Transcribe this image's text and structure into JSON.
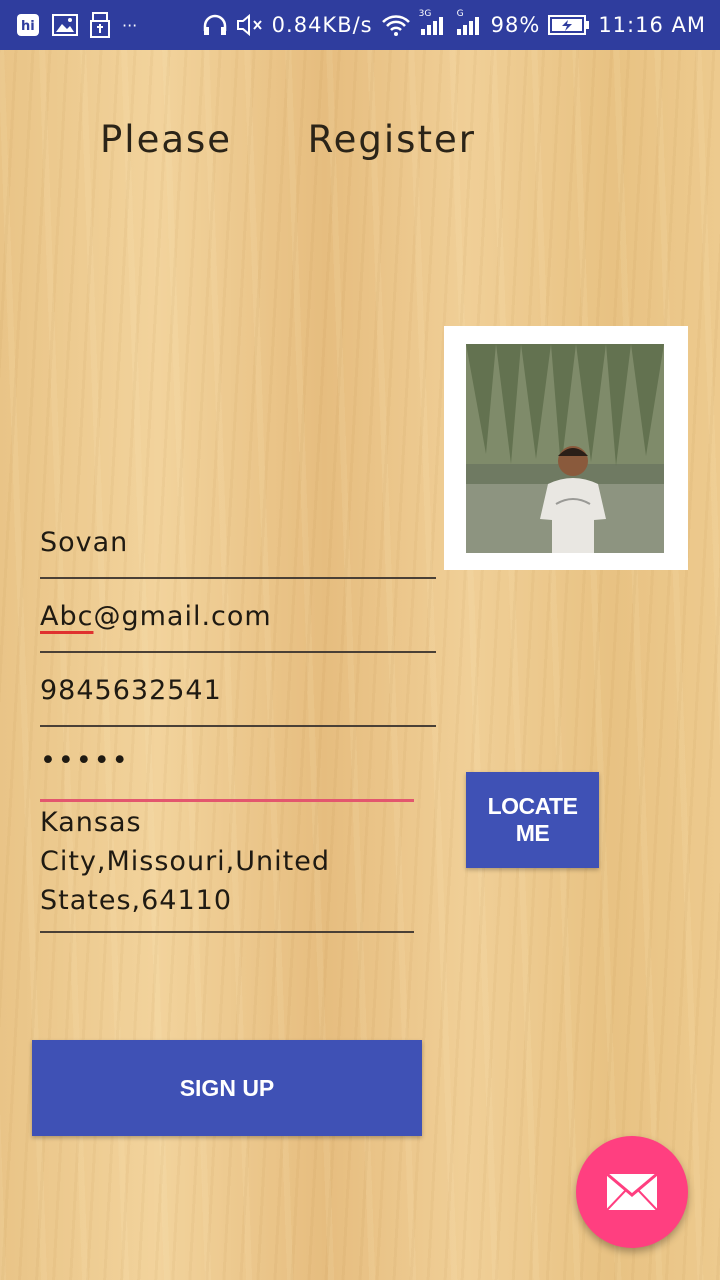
{
  "status_bar": {
    "network_speed": "0.84KB/s",
    "network_type_1": "3G",
    "network_type_2": "G",
    "battery": "98%",
    "time": "11:16 AM",
    "overflow": "···"
  },
  "page": {
    "title": "Please  Register"
  },
  "form": {
    "name_value": "Sovan",
    "email_prefix": "Abc",
    "email_suffix": "@gmail.com",
    "phone_value": "9845632541",
    "password_value": "•••••",
    "address_line1": "Kansas",
    "address_line2": "City,Missouri,United",
    "address_line3": "States,64110"
  },
  "buttons": {
    "locate_label": "LOCATE ME",
    "signup_label": "SIGN UP"
  },
  "colors": {
    "primary": "#3f51b5",
    "accent": "#ff3f80",
    "status_bar": "#2f3d9e"
  }
}
